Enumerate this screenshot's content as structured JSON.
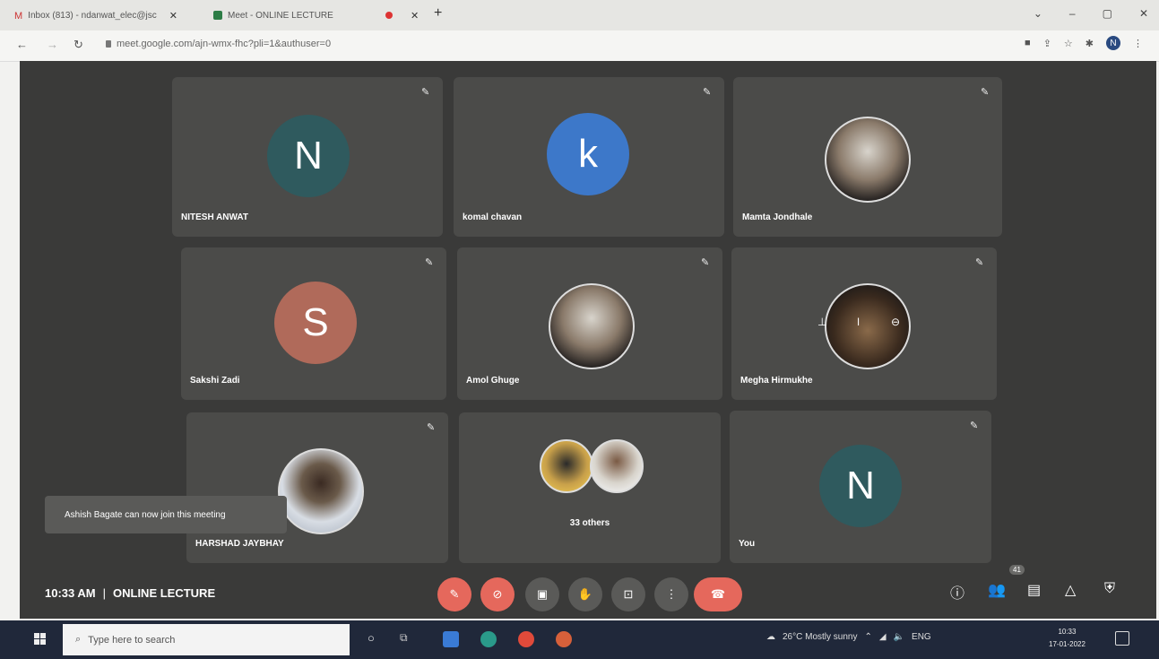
{
  "browser": {
    "tabs": [
      {
        "title": "Inbox (813) - ndanwat_elec@jsc",
        "icon": "gmail-icon"
      },
      {
        "title": "Meet - ONLINE LECTURE",
        "icon": "meet-icon"
      },
      {
        "title": "",
        "icon": "recording-dot-icon"
      }
    ],
    "new_tab": "+",
    "url": "meet.google.com/ajn-wmx-fhc?pli=1&authuser=0",
    "profile_initial": "N"
  },
  "participants": [
    {
      "name": "NITESH ANWAT",
      "initial": "N",
      "avatar_color": "#2f5a5e",
      "type": "initial"
    },
    {
      "name": "komal chavan",
      "initial": "k",
      "avatar_color": "#3d78c9",
      "type": "initial"
    },
    {
      "name": "Mamta Jondhale",
      "type": "photo"
    },
    {
      "name": "Sakshi Zadi",
      "initial": "S",
      "avatar_color": "#b06a5a",
      "type": "initial"
    },
    {
      "name": "Amol Ghuge",
      "type": "photo"
    },
    {
      "name": "Megha Hirmukhe",
      "type": "photo"
    },
    {
      "name": "HARSHAD JAYBHAY",
      "type": "photo"
    },
    {
      "name": "33 others",
      "type": "group"
    },
    {
      "name": "You",
      "initial": "N",
      "avatar_color": "#2f5a5e",
      "type": "initial"
    }
  ],
  "toast": "Ashish Bagate can now join this meeting",
  "meeting": {
    "time": "10:33 AM",
    "separator": "|",
    "title": "ONLINE LECTURE",
    "participant_badge": "41"
  },
  "taskbar": {
    "search_placeholder": "Type here to search",
    "weather": "26°C  Mostly sunny",
    "language": "ENG",
    "time": "10:33",
    "date": "17-01-2022"
  }
}
